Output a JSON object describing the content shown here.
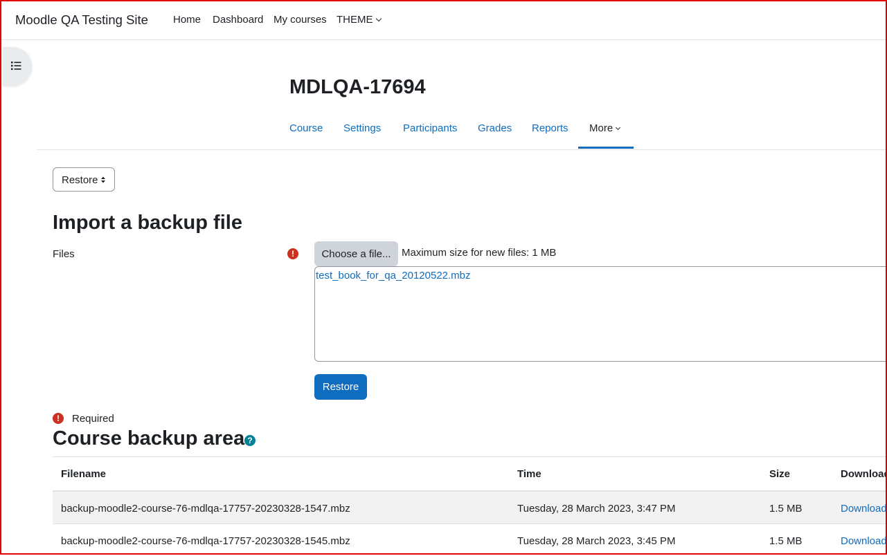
{
  "navbar": {
    "site_name": "Moodle QA Testing Site",
    "links": [
      "Home",
      "Dashboard",
      "My courses",
      "THEME"
    ]
  },
  "course": {
    "title": "MDLQA-17694"
  },
  "secondary_nav": {
    "items": [
      "Course",
      "Settings",
      "Participants",
      "Grades",
      "Reports",
      "More"
    ],
    "active": "More"
  },
  "restore_select": {
    "value": "Restore"
  },
  "import": {
    "heading": "Import a backup file",
    "files_label": "Files",
    "choose_button": "Choose a file...",
    "max_size": "Maximum size for new files: 1 MB",
    "selected_file": "test_book_for_qa_20120522.mbz",
    "restore_button": "Restore",
    "required_label": "Required"
  },
  "backup_area": {
    "heading": "Course backup area",
    "columns": [
      "Filename",
      "Time",
      "Size",
      "Download"
    ],
    "rows": [
      {
        "filename": "backup-moodle2-course-76-mdlqa-17757-20230328-1547.mbz",
        "time": "Tuesday, 28 March 2023, 3:47 PM",
        "size": "1.5 MB",
        "download": "Download"
      },
      {
        "filename": "backup-moodle2-course-76-mdlqa-17757-20230328-1545.mbz",
        "time": "Tuesday, 28 March 2023, 3:45 PM",
        "size": "1.5 MB",
        "download": "Download"
      }
    ]
  },
  "colors": {
    "link": "#0f6cbf",
    "required": "#ca3120",
    "help": "#008196",
    "frame": "#e00000"
  }
}
